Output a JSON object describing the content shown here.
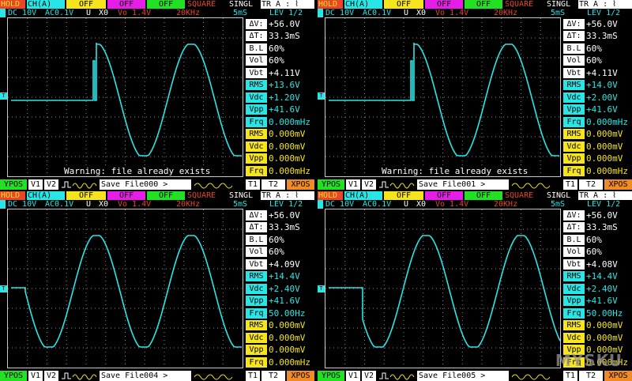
{
  "header": {
    "mode_hold": "HOLD",
    "channel": "CH(A)",
    "off1": "OFF",
    "off2": "OFF",
    "off3": "OFF",
    "wave": "SQUARE",
    "trig_mode": "SINGL",
    "trig_src": "TR A : ⌇",
    "coupling": "DC 10V",
    "probe": "AC0.1V",
    "unit": "U",
    "mult": "X0",
    "vo": "Vo 1.4V",
    "freq": "20KHz",
    "timebase": "5mS",
    "level": "LEV  1/2"
  },
  "footer": {
    "ypos": "YPOS",
    "v1": "V1",
    "v2": "V2",
    "t1": "T1",
    "t2": "T2",
    "xpos": "XPOS"
  },
  "warning_text": "Warning: file already exists",
  "marker_label": "T",
  "panels": [
    {
      "save_label": "Save File000 >",
      "warning": true,
      "meas": [
        {
          "label": "ΔV:",
          "value": "+56.0V",
          "style": "white"
        },
        {
          "label": "ΔT:",
          "value": "33.3mS",
          "style": "white"
        },
        {
          "label": "B.L",
          "value": "60%",
          "style": "white"
        },
        {
          "label": "Vol",
          "value": "60%",
          "style": "white"
        },
        {
          "label": "Vbt",
          "value": "+4.11V",
          "style": "white"
        },
        {
          "label": "RMS",
          "value": "+13.6V",
          "style": "cyan"
        },
        {
          "label": "Vdc",
          "value": "+1.20V",
          "style": "cyan"
        },
        {
          "label": "Vpp",
          "value": "+41.6V",
          "style": "cyan"
        },
        {
          "label": "Frq",
          "value": "0.000mHz",
          "style": "cyan"
        },
        {
          "label": "RMS",
          "value": "0.000mV",
          "style": "yellow"
        },
        {
          "label": "Vdc",
          "value": "0.000mV",
          "style": "yellow"
        },
        {
          "label": "Vpp",
          "value": "0.000mV",
          "style": "yellow"
        },
        {
          "label": "Frq",
          "value": "0.000mHz",
          "style": "yellow"
        }
      ]
    },
    {
      "save_label": "Save File001 >",
      "warning": true,
      "meas": [
        {
          "label": "ΔV:",
          "value": "+56.0V",
          "style": "white"
        },
        {
          "label": "ΔT:",
          "value": "33.3mS",
          "style": "white"
        },
        {
          "label": "B.L",
          "value": "60%",
          "style": "white"
        },
        {
          "label": "Vol",
          "value": "60%",
          "style": "white"
        },
        {
          "label": "Vbt",
          "value": "+4.11V",
          "style": "white"
        },
        {
          "label": "RMS",
          "value": "+14.0V",
          "style": "cyan"
        },
        {
          "label": "Vdc",
          "value": "+2.00V",
          "style": "cyan"
        },
        {
          "label": "Vpp",
          "value": "+41.6V",
          "style": "cyan"
        },
        {
          "label": "Frq",
          "value": "0.000mHz",
          "style": "cyan"
        },
        {
          "label": "RMS",
          "value": "0.000mV",
          "style": "yellow"
        },
        {
          "label": "Vdc",
          "value": "0.000mV",
          "style": "yellow"
        },
        {
          "label": "Vpp",
          "value": "0.000mV",
          "style": "yellow"
        },
        {
          "label": "Frq",
          "value": "0.000mHz",
          "style": "yellow"
        }
      ]
    },
    {
      "save_label": "Save File004 >",
      "warning": false,
      "meas": [
        {
          "label": "ΔV:",
          "value": "+56.0V",
          "style": "white"
        },
        {
          "label": "ΔT:",
          "value": "33.3mS",
          "style": "white"
        },
        {
          "label": "B.L",
          "value": "60%",
          "style": "white"
        },
        {
          "label": "Vol",
          "value": "60%",
          "style": "white"
        },
        {
          "label": "Vbt",
          "value": "+4.09V",
          "style": "white"
        },
        {
          "label": "RMS",
          "value": "+14.4V",
          "style": "cyan"
        },
        {
          "label": "Vdc",
          "value": "+2.40V",
          "style": "cyan"
        },
        {
          "label": "Vpp",
          "value": "+41.6V",
          "style": "cyan"
        },
        {
          "label": "Frq",
          "value": "50.00Hz",
          "style": "cyan"
        },
        {
          "label": "RMS",
          "value": "0.000mV",
          "style": "yellow"
        },
        {
          "label": "Vdc",
          "value": "0.000mV",
          "style": "yellow"
        },
        {
          "label": "Vpp",
          "value": "0.000mV",
          "style": "yellow"
        },
        {
          "label": "Frq",
          "value": "0.000mHz",
          "style": "yellow"
        }
      ]
    },
    {
      "save_label": "Save File005 >",
      "warning": false,
      "meas": [
        {
          "label": "ΔV:",
          "value": "+56.0V",
          "style": "white"
        },
        {
          "label": "ΔT:",
          "value": "33.3mS",
          "style": "white"
        },
        {
          "label": "B.L",
          "value": "60%",
          "style": "white"
        },
        {
          "label": "Vol",
          "value": "60%",
          "style": "white"
        },
        {
          "label": "Vbt",
          "value": "+4.08V",
          "style": "white"
        },
        {
          "label": "RMS",
          "value": "+14.4V",
          "style": "cyan"
        },
        {
          "label": "Vdc",
          "value": "+2.40V",
          "style": "cyan"
        },
        {
          "label": "Vpp",
          "value": "+41.6V",
          "style": "cyan"
        },
        {
          "label": "Frq",
          "value": "50.00Hz",
          "style": "cyan"
        },
        {
          "label": "RMS",
          "value": "0.000mV",
          "style": "yellow"
        },
        {
          "label": "Vdc",
          "value": "0.000mV",
          "style": "yellow"
        },
        {
          "label": "Vpp",
          "value": "0.000mV",
          "style": "yellow"
        },
        {
          "label": "Frq",
          "value": "0.000mHz",
          "style": "yellow"
        }
      ]
    }
  ],
  "watermark": "MYSKU",
  "colors": {
    "trace": "#29e6e6",
    "hold_bg": "#e8452a",
    "channel_bg": "#29e6e6",
    "off1_bg": "#f6e41d",
    "off2_bg": "#e61de6",
    "off3_bg": "#22e022",
    "wave_fg": "#e8452a",
    "ypos_bg": "#22e022",
    "xpos_bg": "#f08a24"
  }
}
